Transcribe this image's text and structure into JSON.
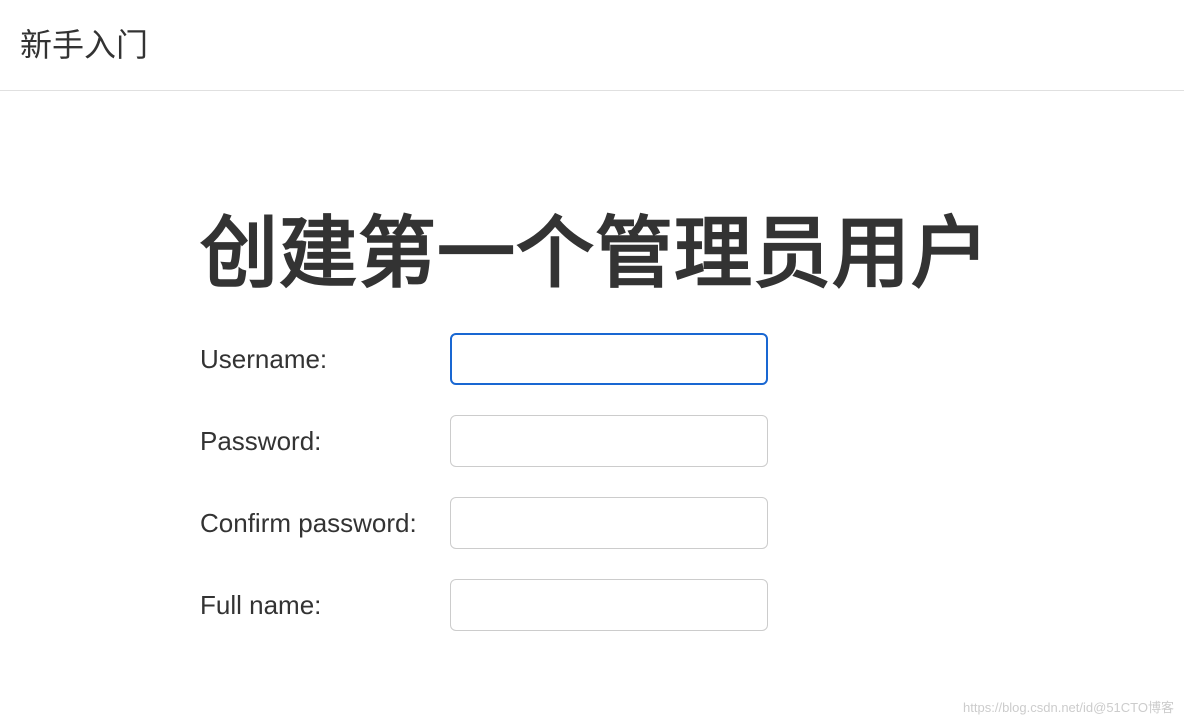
{
  "header": {
    "title": "新手入门"
  },
  "main": {
    "heading": "创建第一个管理员用户",
    "form": {
      "username": {
        "label": "Username:",
        "value": ""
      },
      "password": {
        "label": "Password:",
        "value": ""
      },
      "confirmPassword": {
        "label": "Confirm password:",
        "value": ""
      },
      "fullName": {
        "label": "Full name:",
        "value": ""
      }
    }
  },
  "watermark": "https://blog.csdn.net/id@51CTO博客"
}
